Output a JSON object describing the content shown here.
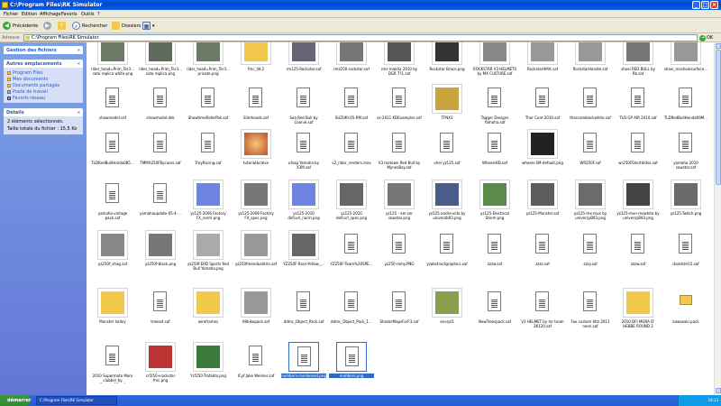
{
  "window": {
    "title": "C:\\Program Files\\RK Simulator"
  },
  "menu": [
    "Fichier",
    "Edition",
    "Affichage",
    "Favoris",
    "Outils",
    "?"
  ],
  "toolbar": {
    "back": "Précédente",
    "search": "Rechercher",
    "folders": "Dossiers"
  },
  "address": {
    "label": "Adresse",
    "value": "C:\\Program Files\\RK Simulator",
    "go": "OK"
  },
  "sidebar": {
    "tasks_title": "Gestion des fichiers",
    "places_title": "Autres emplacements",
    "places": [
      "Program Files",
      "Mes documents",
      "Documents partagés",
      "Poste de travail",
      "Favoris réseau"
    ],
    "details_title": "Détails",
    "details_selected": "2 éléments sélectionnés.",
    "details_size": "Taille totale du fichier : 15,5 Ko"
  },
  "files": [
    [
      "rider_head=Prim_Ter3…soto replica white.png",
      "rider_head=Prim_Ter3…soto replica.png",
      "rider_head=Prim_Ter3…private.png",
      "fmc_lld.2",
      "rm125-Rockstar.saf",
      "rmz250-rockstar.saf",
      "rmz makita 2010 by DGR 7?1.saf",
      "Rockstar Brace.png",
      "ROCKSTAR V3 HELMETS by MX CULTURE.saf",
      "RockstarHMrt.saf",
      "RockstarHandle.saf",
      "shoei RED BULL by Rb.saf",
      "shoei_mxshoeisurface…"
    ],
    [
      "showmodel.saf",
      "showmodel.dds",
      "ShowtimeRiderPak.saf",
      "Slimheads.saf",
      "Sea Red Bull by Coonie.saf",
      "SUZUKI-05-RM.saf",
      "sx-2011 KDExamples.saf",
      "TFNX1",
      "Tagger Designs Yamaha.saf",
      "Thor Core 2010.saf",
      "thorcoreblackwhite.saf",
      "TLD GP AIR 2010.saf",
      "TLDRedBullHonda09M…"
    ],
    [
      "TLDRedBullHonda085…",
      "TMMX250FBycaers.saf",
      "TroyRacing.saf",
      "tutorial&cleve",
      "ufsag Yamaha by X3M.saf",
      "v2_rider_renders.mov",
      "V3 motown Red Bull by MynesBoy.saf",
      "vhei yz125.saf",
      "WheelsHD.saf",
      "wheels-SM-default.png",
      "WR250F.saf",
      "wr250FShortdidos.saf",
      "yamaha 2010 sowstar.saf"
    ],
    [
      "yamaha-vintage pack.saf",
      "yamahaupdate-05-4-…",
      "yz125-2006 Factory FX_norm.png",
      "yz125-2006 Factory FX_spec.png",
      "yz125-2010 defcurl_norm.png",
      "yz125-2010 defcurl_spec.png",
      "yz125 - am ser sowstar.png",
      "yz125-andre-vilIa by univerzb93.png",
      "yz125-Electrical Storm.png",
      "yz125-Monster.saf",
      "yz125-mx-mux by univerzyB93.png",
      "yz125-mxn-mxwhite by univerzyB93.png",
      "yz125-Twitch.png"
    ],
    [
      "yz250f_shag.saf",
      "yz250f-black.png",
      "yz250f-ERD Sports Red Bull Yamaha.png",
      "yz250fmendusbtrie.saf",
      "YZ250F-Race-Yellow_…",
      "YZ250F-Team%20SPE…",
      "yz250-romy.PNG",
      "yzabstractgraphics.saf",
      "zzzw.saf",
      "zzzz.saf",
      "zzzy.saf",
      "zzzw.saf",
      "rbolds(et)1.saf"
    ],
    [
      "Monster Valley",
      "treeset.saf",
      "wireframes",
      "09bikepack.saf",
      "ddmc_Object_Pack.saf",
      "ddmc_Object_Pack_1…",
      "ShaderMapsForF3.saf",
      "envrpl1",
      "NewTreespack.saf",
      "V3 HELMET by mr team 2K120.saf",
      "Fox custom tiltz 2011 neon.saf",
      "2010 DFI MORA D' HEBBE ROUND 2",
      "kawasaki pack"
    ],
    [
      "2010 Supermoto Moro clubber by Pepette23.saf",
      "crf250+rockstar fmc.png",
      "Ycf250-Trafakto.png",
      "ICyf Jake Weimer.saf",
      "numbers-condensed.png",
      "numbers.png"
    ]
  ],
  "taskbar": {
    "start": "démarrer",
    "task": "C:\\Program Files\\RK Simulator",
    "clock": "18:13"
  }
}
